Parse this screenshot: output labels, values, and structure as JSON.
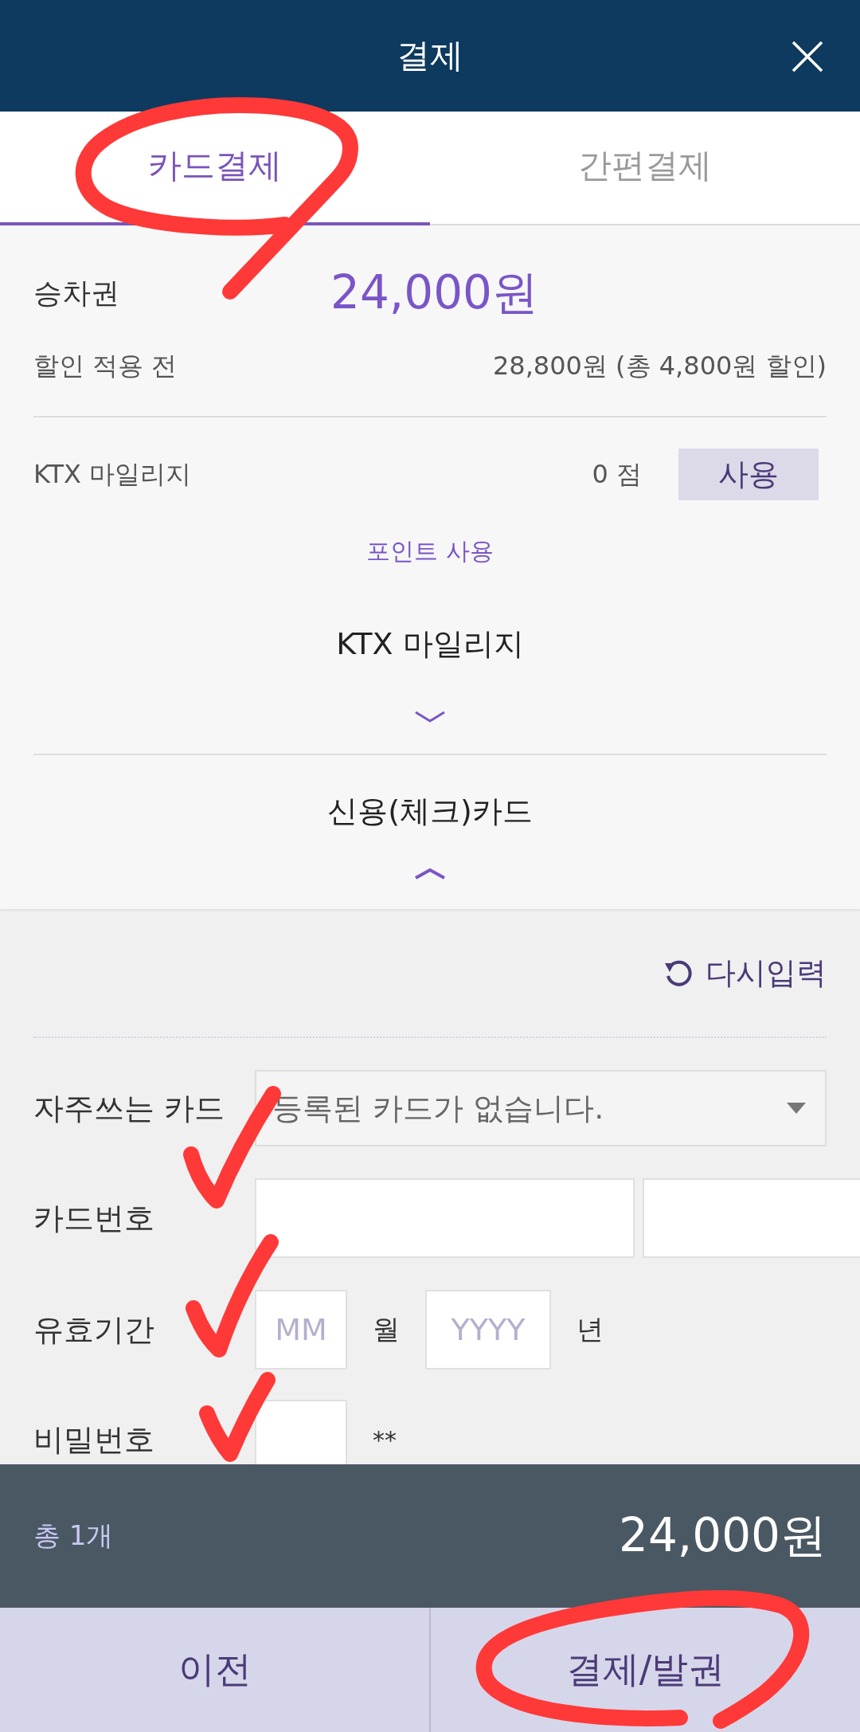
{
  "header": {
    "title": "결제"
  },
  "tabs": [
    {
      "label": "카드결제",
      "selected": true
    },
    {
      "label": "간편결제",
      "selected": false
    }
  ],
  "fare": {
    "label": "승차권",
    "amount": "24,000원"
  },
  "discount": {
    "label": "할인 적용 전",
    "value": "28,800원 (총 4,800원 할인)"
  },
  "mileage": {
    "label": "KTX 마일리지",
    "points": "0 점",
    "button": "사용"
  },
  "points_link": "포인트 사용",
  "sections": [
    {
      "title": "KTX 마일리지",
      "expanded": false
    },
    {
      "title": "신용(체크)카드",
      "expanded": true
    }
  ],
  "card_form": {
    "reset": "다시입력",
    "fields": [
      {
        "kind": "select",
        "label": "자주쓰는 카드",
        "value": "등록된 카드가 없습니다."
      },
      {
        "kind": "card_number",
        "label": "카드번호"
      },
      {
        "kind": "expiry",
        "label": "유효기간",
        "parts": [
          {
            "placeholder": "MM",
            "unit": "월"
          },
          {
            "placeholder": "YYYY",
            "unit": "년"
          }
        ]
      },
      {
        "kind": "password",
        "label": "비밀번호",
        "suffix": "**"
      }
    ]
  },
  "total": {
    "count": "총 1개",
    "amount": "24,000원"
  },
  "buttons": [
    "이전",
    "결제/발권"
  ]
}
